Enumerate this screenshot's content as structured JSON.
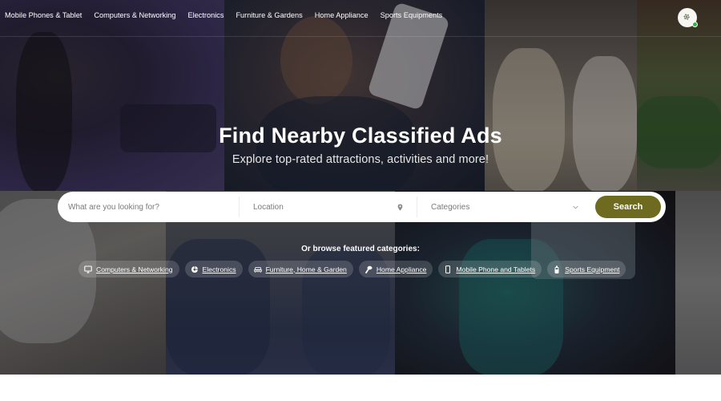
{
  "nav": {
    "items": [
      {
        "label": "Mobile Phones & Tablet"
      },
      {
        "label": "Computers & Networking"
      },
      {
        "label": "Electronics"
      },
      {
        "label": "Furniture & Gardens"
      },
      {
        "label": "Home Appliance"
      },
      {
        "label": "Sports Equipments"
      }
    ],
    "user": {
      "avatar_icon": "leaf-logo-icon",
      "status": "online",
      "status_color": "#2fb344"
    }
  },
  "hero": {
    "title": "Find Nearby Classified Ads",
    "subtitle": "Explore top-rated attractions, activities and more!"
  },
  "search": {
    "keyword_placeholder": "What are you looking for?",
    "keyword_value": "",
    "location_placeholder": "Location",
    "location_value": "",
    "location_icon": "map-pin-icon",
    "categories_selected": "Categories",
    "categories_icon": "chevron-down-icon",
    "button_label": "Search",
    "button_color": "#6e6a1f"
  },
  "featured": {
    "heading": "Or browse featured categories:",
    "categories": [
      {
        "label": "Computers & Networking",
        "icon": "monitor-icon"
      },
      {
        "label": "Electronics",
        "icon": "chip-icon"
      },
      {
        "label": "Furniture, Home & Garden",
        "icon": "sofa-icon"
      },
      {
        "label": "Home Appliance",
        "icon": "hair-dryer-icon"
      },
      {
        "label": "Mobile Phone and Tablets",
        "icon": "phone-icon"
      },
      {
        "label": "Sports Equipment",
        "icon": "bottle-icon"
      }
    ]
  }
}
